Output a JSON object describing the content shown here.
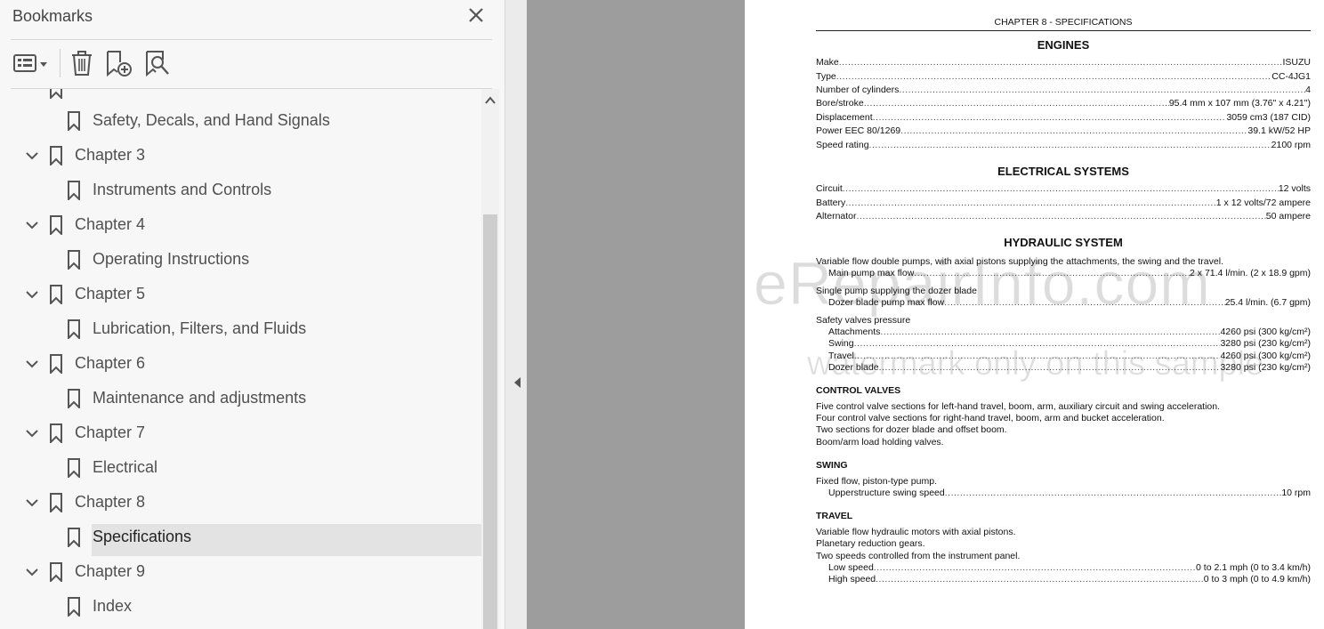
{
  "panel": {
    "title": "Bookmarks",
    "toolbar": {
      "options_icon": "list-options-icon",
      "delete_icon": "trash-icon",
      "new_bookmark_icon": "bookmark-add-icon",
      "find_bookmark_icon": "bookmark-search-icon"
    },
    "tree": [
      {
        "label": "Safety, Decals, and Hand Signals",
        "level": 2
      },
      {
        "label": "Chapter 3",
        "level": 1
      },
      {
        "label": "Instruments and Controls",
        "level": 2
      },
      {
        "label": "Chapter 4",
        "level": 1
      },
      {
        "label": "Operating Instructions",
        "level": 2
      },
      {
        "label": "Chapter 5",
        "level": 1
      },
      {
        "label": "Lubrication, Filters, and Fluids",
        "level": 2
      },
      {
        "label": "Chapter 6",
        "level": 1
      },
      {
        "label": "Maintenance and adjustments",
        "level": 2
      },
      {
        "label": "Chapter 7",
        "level": 1
      },
      {
        "label": "Electrical",
        "level": 2
      },
      {
        "label": "Chapter 8",
        "level": 1
      },
      {
        "label": "Specifications",
        "level": 2,
        "selected": true
      },
      {
        "label": "Chapter 9",
        "level": 1
      },
      {
        "label": "Index",
        "level": 2
      }
    ]
  },
  "document": {
    "header": "CHAPTER 8 - SPECIFICATIONS",
    "engines": {
      "title": "ENGINES",
      "rows": [
        {
          "k": "Make",
          "v": "ISUZU"
        },
        {
          "k": "Type",
          "v": "CC-4JG1"
        },
        {
          "k": "Number of cylinders",
          "v": "4"
        },
        {
          "k": "Bore/stroke",
          "v": "95.4 mm x 107 mm (3.76\" x 4.21\")"
        },
        {
          "k": "Displacement",
          "v": "3059 cm3 (187 CID)"
        },
        {
          "k": "Power EEC 80/1269",
          "v": "39.1 kW/52 HP"
        },
        {
          "k": "Speed rating",
          "v": "2100 rpm"
        }
      ]
    },
    "electrical": {
      "title": "ELECTRICAL SYSTEMS",
      "rows": [
        {
          "k": "Circuit",
          "v": "12 volts"
        },
        {
          "k": "Battery",
          "v": "1 x 12 volts/72 ampere"
        },
        {
          "k": "Alternator",
          "v": "50 ampere"
        }
      ]
    },
    "hydraulic": {
      "title": "HYDRAULIC SYSTEM",
      "pumps_text": "Variable flow double pumps, with axial pistons supplying the attachments, the swing and the travel.",
      "main_pump": {
        "k": "Main pump max flow",
        "v": "2 x 71.4 l/min. (2 x 18.9 gpm)"
      },
      "single_pump_text": "Single pump supplying the dozer blade",
      "dozer_pump": {
        "k": "Dozer blade pump max flow",
        "v": "25.4 l/min. (6.7 gpm)"
      },
      "safety_text": "Safety valves pressure",
      "safety_rows": [
        {
          "k": "Attachments",
          "v": "4260 psi (300 kg/cm²)"
        },
        {
          "k": "Swing",
          "v": "3280 psi (230 kg/cm²)"
        },
        {
          "k": "Travel",
          "v": "4260 psi (300 kg/cm²)"
        },
        {
          "k": "Dozer blade",
          "v": "3280 psi (230 kg/cm²)"
        }
      ]
    },
    "control_valves": {
      "title": "CONTROL VALVES",
      "lines": [
        "Five control valve sections for left-hand travel, boom, arm, auxiliary circuit and swing acceleration.",
        "Four control valve sections for right-hand travel, boom, arm and bucket acceleration.",
        "Two sections for dozer blade and offset boom.",
        "Boom/arm load holding valves."
      ]
    },
    "swing": {
      "title": "SWING",
      "line": "Fixed flow, piston-type pump.",
      "row": {
        "k": "Upperstructure swing speed",
        "v": "10 rpm"
      }
    },
    "travel": {
      "title": "TRAVEL",
      "lines": [
        "Variable flow hydraulic motors with axial pistons.",
        "Planetary reduction gears.",
        "Two speeds controlled from the instrument panel."
      ],
      "rows": [
        {
          "k": "Low speed",
          "v": "0 to 2.1 mph (0 to 3.4 km/h)"
        },
        {
          "k": "High speed",
          "v": "0 to 3 mph (0 to 4.9 km/h)"
        }
      ]
    },
    "watermark": {
      "line1": "eRepairInfo.com",
      "line2": "watermark only on this sample"
    }
  }
}
